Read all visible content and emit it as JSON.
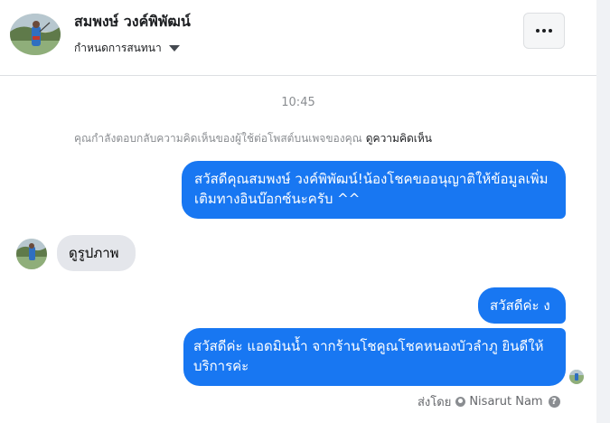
{
  "header": {
    "name": "สมพงษ์ วงค์พิพัฒน์",
    "subtitle": "กำหนดการสนทนา",
    "more_icon": "more-horizontal-icon"
  },
  "conversation": {
    "timestamp": "10:45",
    "notice": "คุณกำลังตอบกลับความคิดเห็นของผู้ใช้ต่อโพสต์บนเพจของคุณ",
    "notice_link": "ดูความคิดเห็น",
    "messages": [
      {
        "direction": "outgoing",
        "text": "สวัสดีคุณสมพงษ์ วงค์พิพัฒน์!น้องโชคขออนุญาติให้ข้อมูลเพิ่มเติมทางอินบ๊อกซ์นะครับ ^^"
      },
      {
        "direction": "incoming",
        "text": "ดูรูปภาพ"
      },
      {
        "direction": "outgoing",
        "text": "สวัสดีค่ะ ง"
      },
      {
        "direction": "outgoing",
        "text": "สวัสดีค่ะ แอดมินน้ำ จากร้านโชคูณโชคหนองบัวลำภู ยินดีให้บริการค่ะ"
      }
    ],
    "sent_by_label": "ส่งโดย",
    "sent_by_name": "Nisarut Nam"
  },
  "colors": {
    "outgoing_bubble": "#1877f2",
    "incoming_bubble": "#e4e6eb",
    "muted_text": "#8a8d91"
  }
}
